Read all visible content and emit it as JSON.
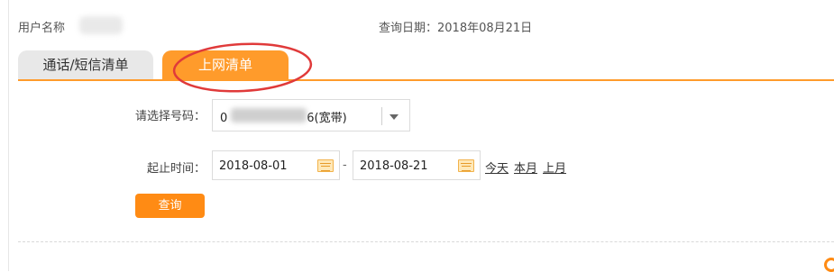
{
  "header": {
    "user_label": "用户名称",
    "query_date": "查询日期：2018年08月21日"
  },
  "tabs": [
    {
      "label": "通话/短信清单",
      "active": false
    },
    {
      "label": "上网清单",
      "active": true
    }
  ],
  "form": {
    "number_label": "请选择号码：",
    "number_value_prefix": "0",
    "number_value_suffix": "6(宽带)",
    "time_label": "起止时间：",
    "date_from": "2018-08-01",
    "date_to": "2018-08-21",
    "separator": "-",
    "quick_links": [
      "今天",
      "本月",
      "上月"
    ],
    "submit_label": "查询"
  },
  "colors": {
    "accent": "#ff9b2b",
    "button": "#ff8b14",
    "annotation": "#e03a3a"
  }
}
